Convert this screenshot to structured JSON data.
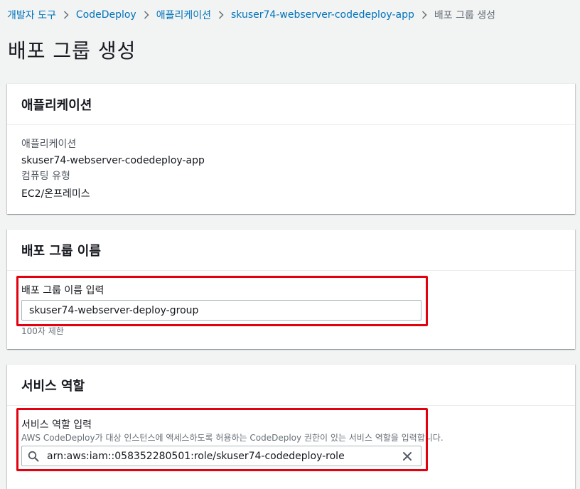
{
  "breadcrumb": {
    "items": [
      {
        "label": "개발자 도구"
      },
      {
        "label": "CodeDeploy"
      },
      {
        "label": "애플리케이션"
      },
      {
        "label": "skuser74-webserver-codedeploy-app"
      }
    ],
    "current": "배포 그룹 생성"
  },
  "page": {
    "title": "배포 그룹 생성"
  },
  "application_panel": {
    "title": "애플리케이션",
    "app_label": "애플리케이션",
    "app_value": "skuser74-webserver-codedeploy-app",
    "platform_label": "컴퓨팅 유형",
    "platform_value": "EC2/온프레미스"
  },
  "group_panel": {
    "title": "배포 그룹 이름",
    "field_label": "배포 그룹 이름 입력",
    "field_value": "skuser74-webserver-deploy-group",
    "constraint": "100자 제한"
  },
  "role_panel": {
    "title": "서비스 역할",
    "field_label": "서비스 역할 입력",
    "field_desc": "AWS CodeDeploy가 대상 인스턴스에 액세스하도록 허용하는 CodeDeploy 권한이 있는 서비스 역할을 입력합니다.",
    "field_value": "arn:aws:iam::058352280501:role/skuser74-codedeploy-role"
  },
  "colors": {
    "link": "#0073bb",
    "highlight": "#e3000f",
    "background": "#f2f3f3"
  },
  "icons": {
    "separator": "chevron-right-icon",
    "search": "search-icon",
    "clear": "close-icon"
  }
}
